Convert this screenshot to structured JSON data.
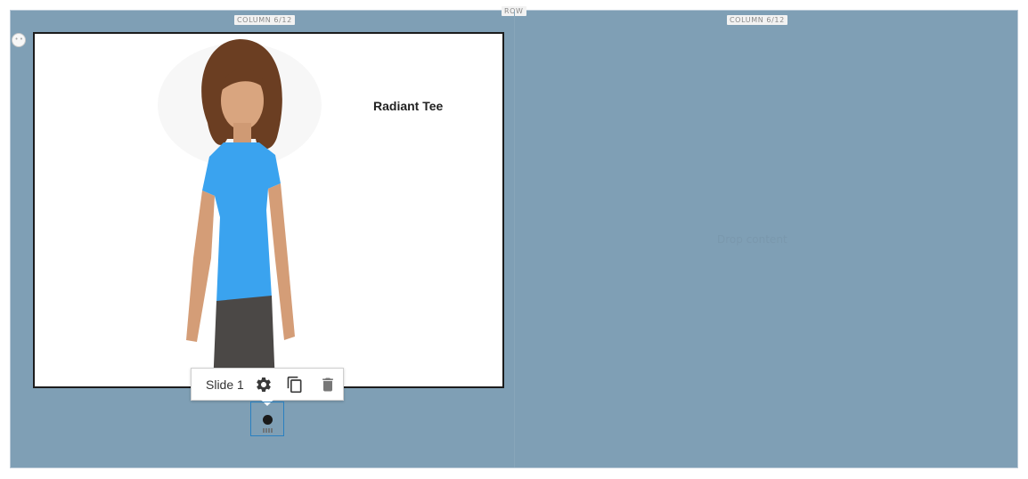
{
  "row": {
    "label": "ROW"
  },
  "columns": [
    {
      "label": "COLUMN 6/12"
    },
    {
      "label": "COLUMN 6/12",
      "empty_text": "Drop content"
    }
  ],
  "slide": {
    "title": "Radiant Tee"
  },
  "toolbar": {
    "label": "Slide 1",
    "icons": [
      "gear-icon",
      "copy-icon",
      "trash-icon"
    ]
  },
  "colors": {
    "row_background": "#7f9fb5",
    "active_dot": "#1a1a1a",
    "nav_border": "#2a80c0"
  }
}
